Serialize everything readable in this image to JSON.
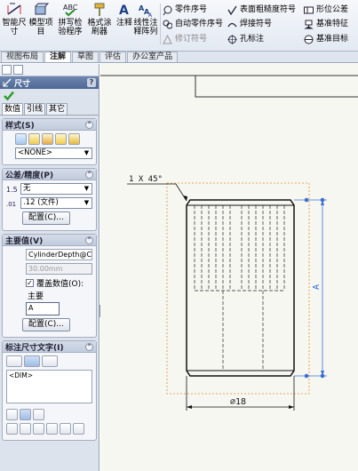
{
  "ribbon": {
    "big_buttons": [
      {
        "label": "智能尺寸",
        "icon": "smart-dimension-icon"
      },
      {
        "label": "模型项目",
        "icon": "model-items-icon"
      },
      {
        "label": "拼写检验程序",
        "icon": "spell-check-icon"
      },
      {
        "label": "格式涂刷器",
        "icon": "format-painter-icon"
      },
      {
        "label": "注释",
        "icon": "note-icon"
      },
      {
        "label": "线性注释阵列",
        "icon": "linear-note-pattern-icon"
      }
    ],
    "small_col1": [
      {
        "label": "零件序号",
        "icon": "balloon-icon"
      },
      {
        "label": "自动零件序号",
        "icon": "auto-balloon-icon"
      },
      {
        "label": "修订符号",
        "icon": "revision-symbol-icon"
      }
    ],
    "small_col2": [
      {
        "label": "表面粗糙度符号",
        "icon": "surface-finish-icon"
      },
      {
        "label": "焊接符号",
        "icon": "weld-symbol-icon"
      },
      {
        "label": "孔标注",
        "icon": "hole-callout-icon"
      }
    ],
    "small_col3": [
      {
        "label": "形位公差",
        "icon": "geometric-tolerance-icon"
      },
      {
        "label": "基准特征",
        "icon": "datum-feature-icon"
      },
      {
        "label": "基准目标",
        "icon": "datum-target-icon"
      }
    ]
  },
  "tabs": [
    "视图布局",
    "注解",
    "草图",
    "评估",
    "办公室产品"
  ],
  "active_tab": "注解",
  "panel": {
    "title": "尺寸",
    "help": "?",
    "subtabs": [
      "数值",
      "引线",
      "其它"
    ],
    "style_group": {
      "title": "样式(S)",
      "select": "<NONE>"
    },
    "tolerance_group": {
      "title": "公差/精度(P)",
      "tolerance_select": "无",
      "precision_select": ".12 (文件)",
      "config_button": "配置(C)..."
    },
    "primary_group": {
      "title": "主要值(V)",
      "reference": "CylinderDepth@Cylinc",
      "value": "30.00mm",
      "override_label": "覆盖数值(O):",
      "override_checked": true,
      "main_label": "主要",
      "main_value": "A",
      "config_button": "配置(C)..."
    },
    "dimtext_group": {
      "title": "标注尺寸文字(I)",
      "text": "<DIM>"
    }
  },
  "drawing": {
    "chamfer_note": "1 X 45°",
    "diameter_dim": "∅18",
    "height_dim": "A"
  }
}
